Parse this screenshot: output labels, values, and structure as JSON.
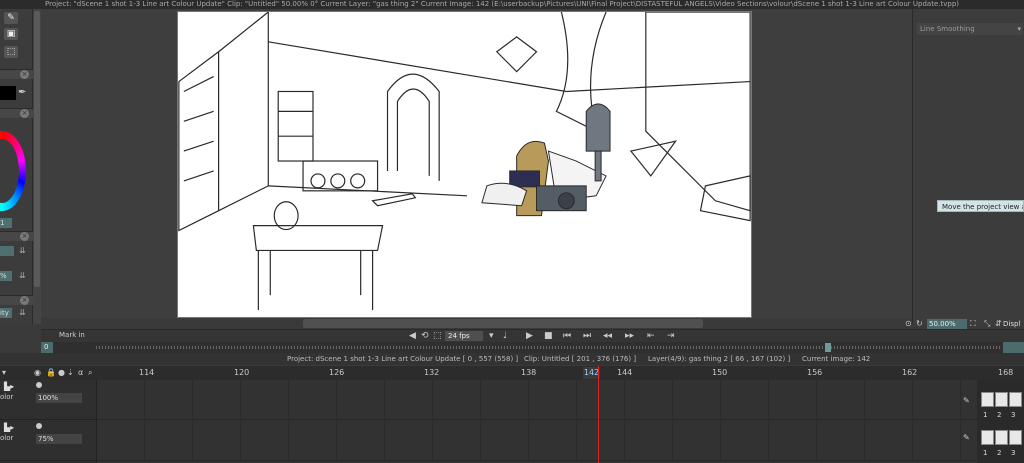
{
  "window": {
    "title": "Project: \"dScene 1 shot 1-3 Line art Colour Update\"  Clip: \"Untitled\"  50.00%  0°  Current Layer: \"gas thing 2\"  Current Image: 142 (E:\\userbackup\\Pictures\\UNI\\Final Project\\DISTASTEFUL ANGELS\\Video Sections\\volour\\dScene 1 shot 1-3 Line art Colour Update.tvpp)"
  },
  "left_panel": {
    "values": [
      "1",
      "%",
      "ity"
    ],
    "side_arrows": [
      "⇊",
      "⇊",
      "⇊"
    ],
    "blank_values": [
      "",
      ""
    ]
  },
  "right_panel": {
    "line_smoothing": "Line Smoothing"
  },
  "tooltip": "Move the project view around",
  "zoom": {
    "value": "50.00%",
    "display_label": "Displ"
  },
  "transport": {
    "mark_in": "Mark in",
    "fps": "24 fps"
  },
  "time_slider": {
    "start": "0"
  },
  "info_bar": {
    "project": "Project: dScene 1 shot 1-3 Line art Colour Update [ 0 , 557  (558) ]",
    "clip": "Clip: Untitled [ 201 , 376  (176) ]",
    "layer": "Layer(4/9): gas thing 2 [ 66 , 167  (102) ]",
    "current_image": "Current image: 142"
  },
  "timeline": {
    "frames": [
      "114",
      "120",
      "126",
      "132",
      "138",
      "142",
      "144",
      "150",
      "156",
      "162",
      "168"
    ],
    "current_frame": "142",
    "layers": [
      {
        "name": "olor",
        "opacity": "100%"
      },
      {
        "name": "olor",
        "opacity": "75%"
      }
    ],
    "thumbs": [
      "1",
      "2",
      "3"
    ]
  }
}
